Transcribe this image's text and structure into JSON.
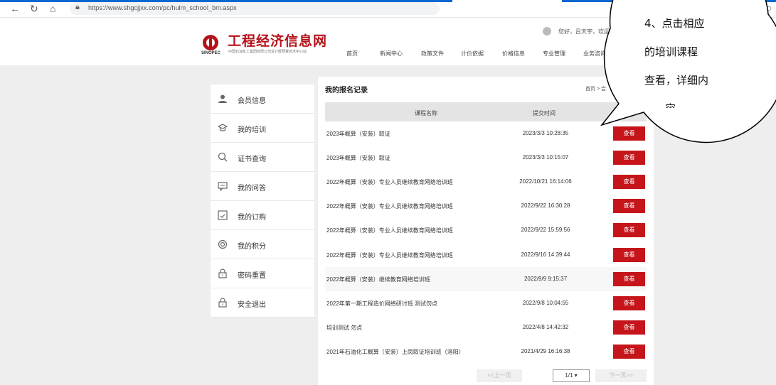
{
  "browser": {
    "url": "https://www.shgcjjxx.com/pc/hulm_school_bm.aspx",
    "icons": [
      "back-arrow-icon",
      "reload-icon",
      "home-icon",
      "lock-icon"
    ]
  },
  "site": {
    "logo_title": "工程经济信息网",
    "logo_subtitle": "中国石油化工集团有限公司设计概预算技术中心站",
    "logo_en": "SINOPEC",
    "greeting": "您好，吕天宇，欢迎",
    "nav": [
      "首页",
      "新闻中心",
      "政策文件",
      "计价依据",
      "价格信息",
      "专业管理",
      "业务咨询"
    ]
  },
  "sidebar": {
    "items": [
      {
        "label": "会员信息",
        "icon": "user-icon"
      },
      {
        "label": "我的培训",
        "icon": "graduation-cap-icon"
      },
      {
        "label": "证书查询",
        "icon": "search-icon"
      },
      {
        "label": "我的问答",
        "icon": "chat-icon"
      },
      {
        "label": "我的订购",
        "icon": "order-check-icon"
      },
      {
        "label": "我的积分",
        "icon": "points-icon"
      },
      {
        "label": "密码重置",
        "icon": "lock-icon"
      },
      {
        "label": "安全退出",
        "icon": "lock-exit-icon"
      }
    ]
  },
  "main": {
    "title": "我的报名记录",
    "breadcrumb": "首页 > 会",
    "col_name": "课程名称",
    "col_time": "提交时间",
    "view_label": "查看",
    "rows": [
      {
        "name": "2023年概算（安装）取证",
        "time": "2023/3/3 10:28:35"
      },
      {
        "name": "2023年概算（安装）取证",
        "time": "2023/3/3 10:15:07"
      },
      {
        "name": "2022年概算（安装）专业人员继续教育网络培训班",
        "time": "2022/10/21 16:14:06"
      },
      {
        "name": "2022年概算（安装）专业人员继续教育网络培训班",
        "time": "2022/9/22 16:30:28"
      },
      {
        "name": "2022年概算（安装）专业人员继续教育网络培训班",
        "time": "2022/9/22 15:59:56"
      },
      {
        "name": "2022年概算（安装）专业人员继续教育网络培训班",
        "time": "2022/9/16 14:39:44"
      },
      {
        "name": "2022年概算（安装）继续教育网络培训班",
        "time": "2022/9/9 9:15:37"
      },
      {
        "name": "2022年第一期工程造价网络研讨班 测试勿点",
        "time": "2022/9/8 10:04:55"
      },
      {
        "name": "培训测试 勿点",
        "time": "2022/4/8 14:42:32"
      },
      {
        "name": "2021年石油化工概算（安装）上岗取证培训班（洛阳）",
        "time": "2021/4/29 16:16:38"
      }
    ],
    "highlighted_row": 6,
    "pager": {
      "prev": "<<上一页",
      "page": "1/1 ▾",
      "next": "下一页>>"
    }
  },
  "callout": {
    "lines": [
      "4、点击相应",
      "的培训课程",
      "查看，详细内",
      "容"
    ]
  },
  "colors": {
    "accent": "#c5151b",
    "brand": "#b5121b",
    "bg": "#eeeeee"
  }
}
